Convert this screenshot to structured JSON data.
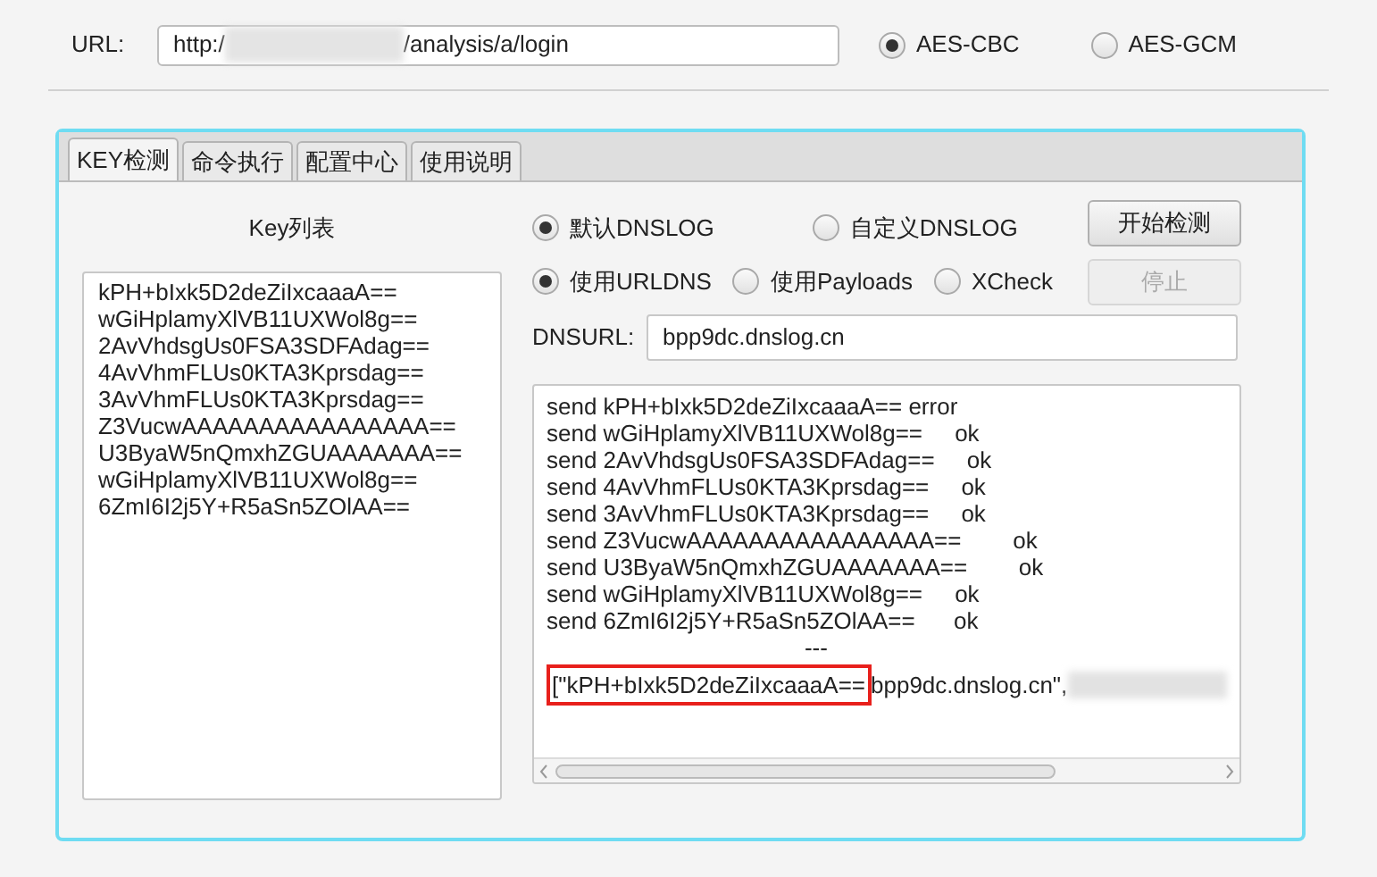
{
  "url": {
    "label": "URL:",
    "value_start": "http:/",
    "value_end": "/analysis/a/login",
    "redacted": true
  },
  "cipher_modes": [
    {
      "label": "AES-CBC",
      "selected": true
    },
    {
      "label": "AES-GCM",
      "selected": false
    }
  ],
  "tabs": [
    {
      "label": "KEY检测",
      "selected": true
    },
    {
      "label": "命令执行",
      "selected": false
    },
    {
      "label": "配置中心",
      "selected": false
    },
    {
      "label": "使用说明",
      "selected": false
    }
  ],
  "key_list": {
    "title": "Key列表",
    "keys": [
      "kPH+bIxk5D2deZiIxcaaaA==",
      "wGiHplamyXlVB11UXWol8g==",
      "2AvVhdsgUs0FSA3SDFAdag==",
      "4AvVhmFLUs0KTA3Kprsdag==",
      "3AvVhmFLUs0KTA3Kprsdag==",
      "Z3VucwAAAAAAAAAAAAAAAA==",
      "U3ByaW5nQmxhZGUAAAAAAA==",
      "wGiHplamyXlVB11UXWol8g==",
      "6ZmI6I2j5Y+R5aSn5ZOlAA=="
    ]
  },
  "dnslog_options": [
    {
      "label": "默认DNSLOG",
      "selected": true
    },
    {
      "label": "自定义DNSLOG",
      "selected": false
    }
  ],
  "payload_options": [
    {
      "label": "使用URLDNS",
      "selected": true
    },
    {
      "label": "使用Payloads",
      "selected": false
    },
    {
      "label": "XCheck",
      "selected": false
    }
  ],
  "buttons": [
    {
      "label": "开始检测",
      "disabled": false
    },
    {
      "label": "停止",
      "disabled": true
    }
  ],
  "dnsurl": {
    "label": "DNSURL:",
    "value": "bpp9dc.dnslog.cn"
  },
  "log": {
    "lines": [
      {
        "text": "send kPH+bIxk5D2deZiIxcaaaA== error"
      },
      {
        "text": "send wGiHplamyXlVB11UXWol8g==     ok"
      },
      {
        "text": "send 2AvVhdsgUs0FSA3SDFAdag==     ok"
      },
      {
        "text": "send 4AvVhmFLUs0KTA3Kprsdag==     ok"
      },
      {
        "text": "send 3AvVhmFLUs0KTA3Kprsdag==     ok"
      },
      {
        "text": "send Z3VucwAAAAAAAAAAAAAAAA==        ok"
      },
      {
        "text": "send U3ByaW5nQmxhZGUAAAAAAA==        ok"
      },
      {
        "text": "send wGiHplamyXlVB11UXWol8g==     ok"
      },
      {
        "text": "send 6ZmI6I2j5Y+R5aSn5ZOlAA==      ok"
      },
      {
        "text": "                                        ---"
      }
    ],
    "result": {
      "highlighted": "[\"kPH+bIxk5D2deZiIxcaaaA==",
      "rest": "bpp9dc.dnslog.cn\",",
      "redacted": true
    }
  }
}
